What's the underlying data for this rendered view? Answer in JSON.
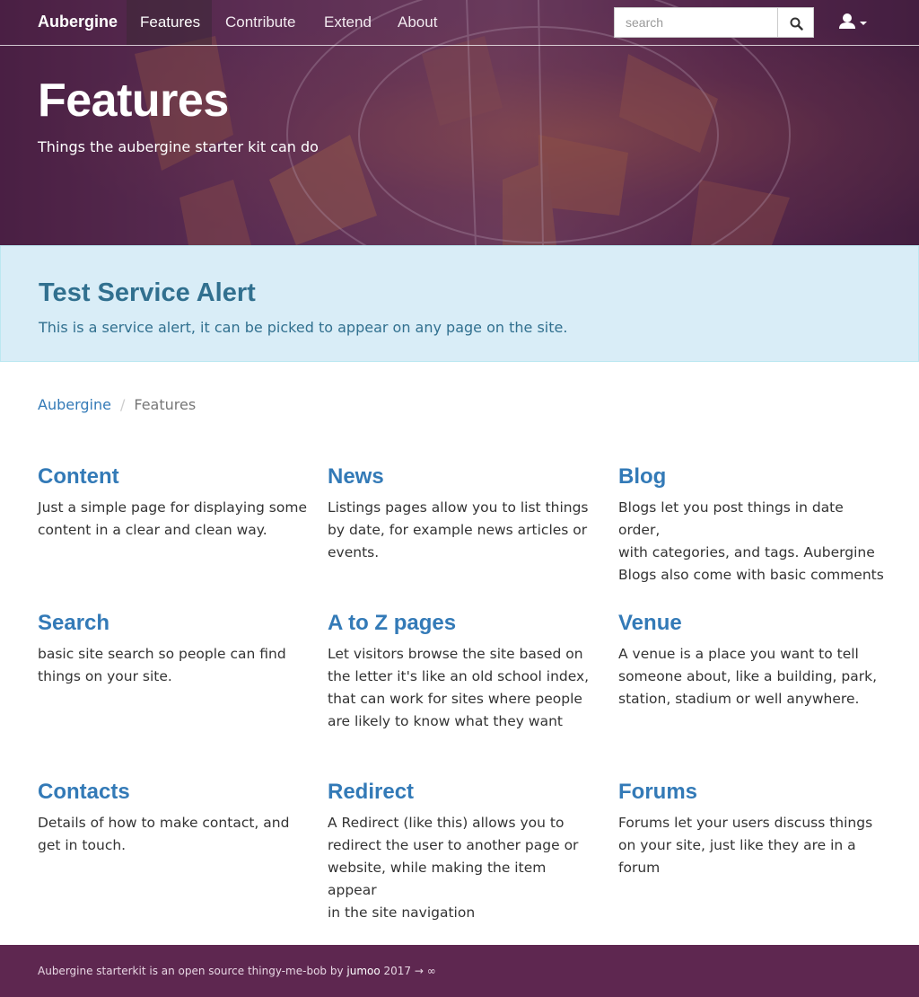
{
  "navbar": {
    "brand": "Aubergine",
    "items": [
      {
        "label": "Features",
        "active": true
      },
      {
        "label": "Contribute",
        "active": false
      },
      {
        "label": "Extend",
        "active": false
      },
      {
        "label": "About",
        "active": false
      }
    ],
    "search_placeholder": "search",
    "search_icon": "search-icon",
    "user_icon": "user-icon"
  },
  "hero": {
    "title": "Features",
    "subtitle": "Things the aubergine starter kit can do"
  },
  "alert": {
    "title": "Test Service Alert",
    "text": "This is a service alert, it can be picked to appear on any page on the site."
  },
  "breadcrumb": {
    "home": "Aubergine",
    "separator": "/",
    "current": "Features"
  },
  "features": [
    {
      "title": "Content",
      "lines": [
        "Just a simple page for displaying some",
        "content in a clear and clean way."
      ]
    },
    {
      "title": "News",
      "lines": [
        "Listings pages allow you to list things",
        "by date, for example news articles or",
        "events."
      ]
    },
    {
      "title": "Blog",
      "lines": [
        "Blogs let you post things in date order,",
        "with categories, and tags. Aubergine",
        "Blogs also come with basic comments"
      ]
    },
    {
      "title": "Search",
      "lines": [
        "basic site search so people can find",
        "things on your site."
      ]
    },
    {
      "title": "A to Z pages",
      "lines": [
        "Let visitors browse the site based on",
        "the letter it's like an old school index,",
        "that can work for sites where people",
        "are likely to know what they want"
      ]
    },
    {
      "title": "Venue",
      "lines": [
        "A venue is a place you want to tell",
        "someone about, like a building, park,",
        "station, stadium or well anywhere."
      ]
    },
    {
      "title": "Contacts",
      "lines": [
        "Details of how to make contact, and",
        "get in touch."
      ]
    },
    {
      "title": "Redirect",
      "lines": [
        "A Redirect (like this) allows you to",
        "redirect the user to another page or",
        "website, while making the item appear",
        "in the site navigation"
      ]
    },
    {
      "title": "Forums",
      "lines": [
        "Forums let your users discuss things",
        "on your site, just like they are in a",
        "forum"
      ]
    }
  ],
  "footer": {
    "text": "Aubergine starterkit is an open source thingy-me-bob by ",
    "link": "jumoo",
    "suffix": " 2017 → ∞"
  },
  "colors": {
    "brand": "#5e2750",
    "link": "#337ab7",
    "alert_bg": "#d9edf7",
    "alert_text": "#31708f"
  }
}
